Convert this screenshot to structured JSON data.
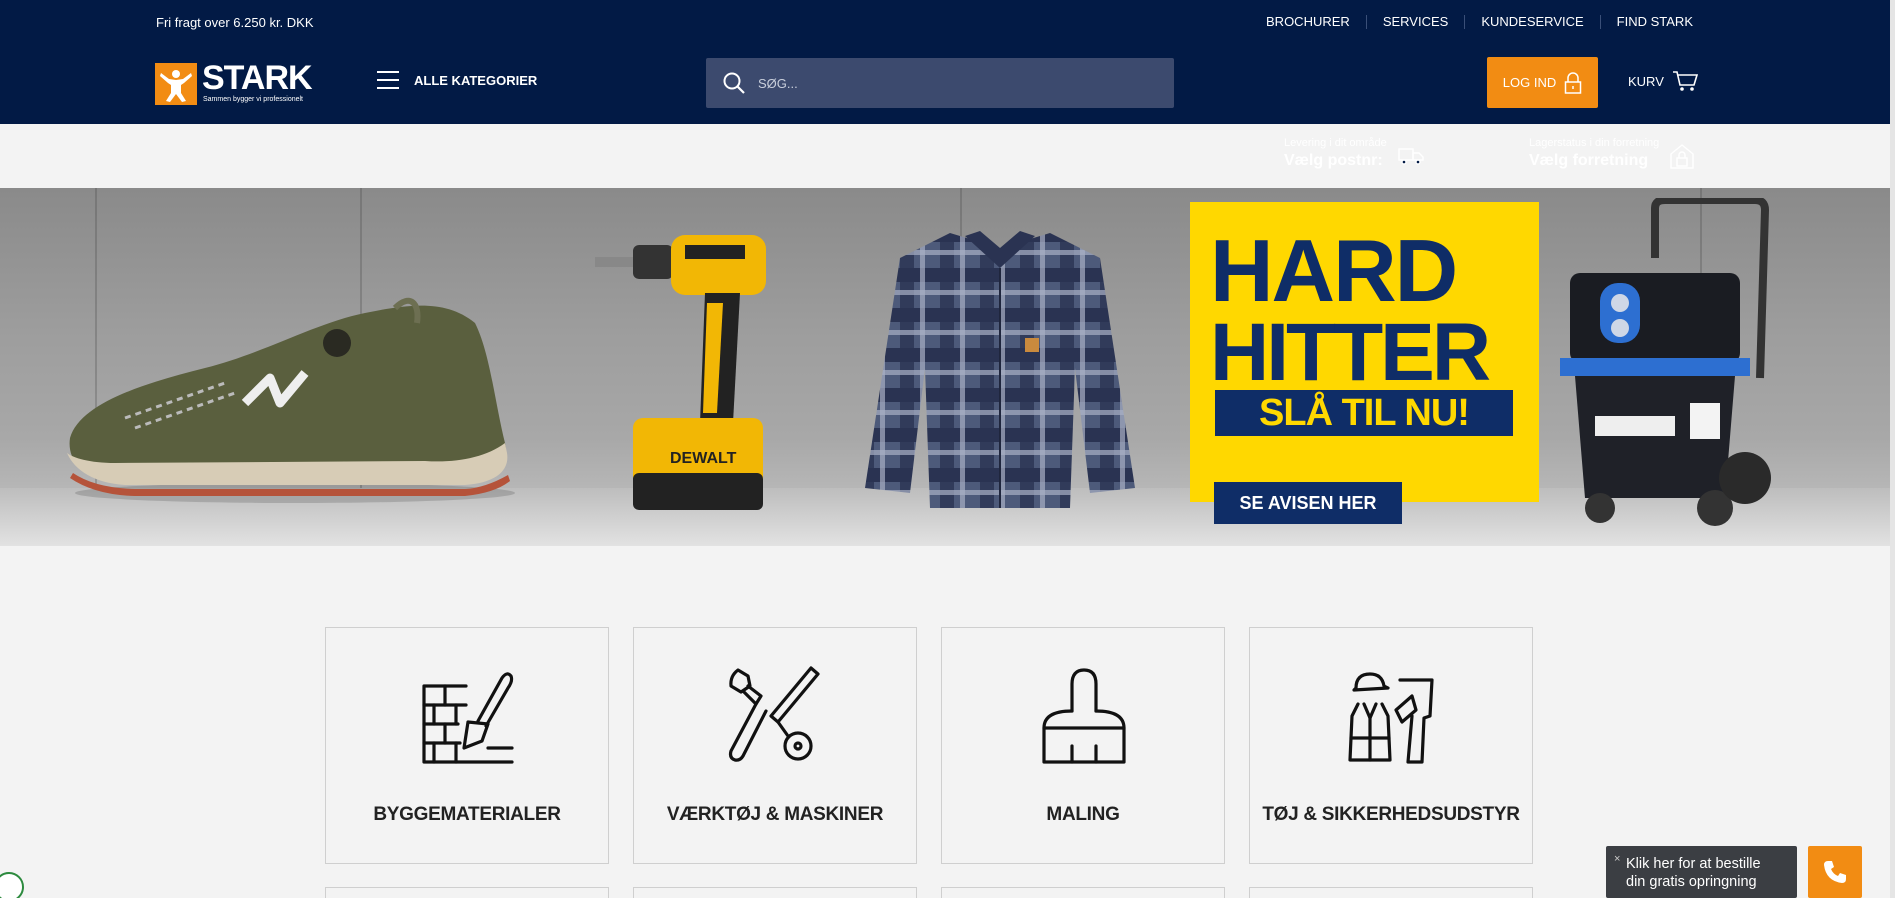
{
  "header": {
    "freight_text": "Fri fragt over 6.250 kr. DKK",
    "top_links": [
      "BROCHURER",
      "SERVICES",
      "KUNDESERVICE",
      "FIND STARK"
    ],
    "logo_text": "STARK",
    "logo_tagline": "Sammen bygger vi professionelt",
    "all_categories": "ALLE KATEGORIER",
    "search_placeholder": "SØG...",
    "login_label": "LOG IND",
    "cart_label": "KURV",
    "delivery": {
      "small": "Levering i dit område",
      "big": "Vælg postnr:"
    },
    "stock": {
      "small": "Lagerstatus i din forretning",
      "big": "Vælg forretning"
    }
  },
  "hero": {
    "line1": "HARD",
    "line2": "HITTER",
    "line3": "SLÅ TIL NU!",
    "button": "SE AVISEN HER"
  },
  "categories": [
    {
      "label": "BYGGEMATERIALER",
      "icon": "brick-trowel-icon"
    },
    {
      "label": "VÆRKTØJ & MASKINER",
      "icon": "wrench-screwdriver-icon"
    },
    {
      "label": "MALING",
      "icon": "paintbrush-icon"
    },
    {
      "label": "TØJ & SIKKERHEDSUDSTYR",
      "icon": "workwear-icon"
    }
  ],
  "callback": {
    "close": "×",
    "text_line1": "Klik her for at bestille",
    "text_line2": "din gratis opringning"
  },
  "colors": {
    "navy": "#021a45",
    "orange": "#f28c13",
    "promo_yellow": "#ffd800",
    "promo_blue": "#0f2d67"
  }
}
